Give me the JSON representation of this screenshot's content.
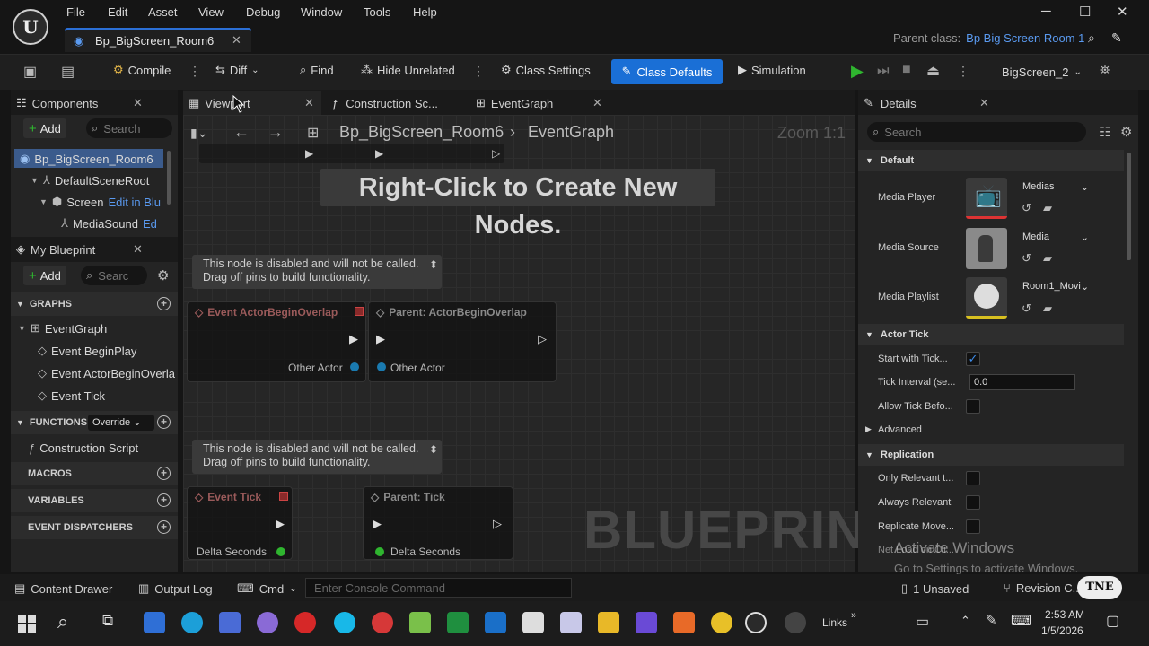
{
  "menu": [
    "File",
    "Edit",
    "Asset",
    "View",
    "Debug",
    "Window",
    "Tools",
    "Help"
  ],
  "doc_tab": "Bp_BigScreen_Room6",
  "parent_class": {
    "label": "Parent class:",
    "value": "Bp Big Screen Room 1"
  },
  "toolbar": {
    "compile": "Compile",
    "diff": "Diff",
    "find": "Find",
    "hide_unrelated": "Hide Unrelated",
    "class_settings": "Class Settings",
    "class_defaults": "Class Defaults",
    "simulation": "Simulation",
    "debug_object": "BigScreen_2"
  },
  "components": {
    "title": "Components",
    "add": "Add",
    "search_placeholder": "Search",
    "tree": [
      {
        "label": "Bp_BigScreen_Room6",
        "extra": ""
      },
      {
        "label": "DefaultSceneRoot",
        "extra": ""
      },
      {
        "label": "Screen",
        "extra": "Edit in Blu"
      },
      {
        "label": "MediaSound",
        "extra": "Ed"
      }
    ]
  },
  "my_blueprint": {
    "title": "My Blueprint",
    "add": "Add",
    "search_placeholder": "Searc",
    "graphs_label": "GRAPHS",
    "graphs": [
      "EventGraph",
      "Event BeginPlay",
      "Event ActorBeginOverla",
      "Event Tick"
    ],
    "functions_label": "FUNCTIONS (",
    "override_label": "Override",
    "functions": [
      "Construction Script"
    ],
    "macros_label": "MACROS",
    "variables_label": "VARIABLES",
    "dispatchers_label": "EVENT DISPATCHERS"
  },
  "graph_tabs": [
    "Viewport",
    "Construction Sc...",
    "EventGraph"
  ],
  "graph": {
    "breadcrumb_root": "Bp_BigScreen_Room6",
    "breadcrumb_leaf": "EventGraph",
    "zoom": "Zoom 1:1",
    "hint": "Right-Click to Create New Nodes.",
    "watermark": "BLUEPRINT",
    "disabled_note_1": "This node is disabled and will not be called.",
    "disabled_note_2": "Drag off pins to build functionality.",
    "node_overlap": "Event ActorBeginOverlap",
    "node_parent_overlap": "Parent: ActorBeginOverlap",
    "pin_other_actor": "Other Actor",
    "node_tick": "Event Tick",
    "node_parent_tick": "Parent: Tick",
    "pin_delta_seconds": "Delta Seconds"
  },
  "details": {
    "title": "Details",
    "search_placeholder": "Search",
    "default_label": "Default",
    "media_player_label": "Media Player",
    "media_player_value": "Medias",
    "media_source_label": "Media Source",
    "media_source_value": "Media",
    "media_playlist_label": "Media Playlist",
    "media_playlist_value": "Room1_Movi",
    "actor_tick_label": "Actor Tick",
    "start_with_tick": "Start with Tick...",
    "tick_interval": "Tick Interval (se...",
    "tick_interval_value": "0.0",
    "allow_tick_before": "Allow Tick Befo...",
    "advanced_label": "Advanced",
    "replication_label": "Replication",
    "only_relevant": "Only Relevant t...",
    "always_relevant": "Always Relevant",
    "replicate_movement": "Replicate Move...",
    "net_partial": "Net Load on Cli..."
  },
  "bottom": {
    "content_drawer": "Content Drawer",
    "output_log": "Output Log",
    "cmd": "Cmd",
    "console_placeholder": "Enter Console Command",
    "unsaved": "1 Unsaved",
    "revision_control": "Revision C..."
  },
  "activate": {
    "line1": "Activate Windows",
    "line2": "Go to Settings to activate Windows."
  },
  "taskbar": {
    "links": "Links",
    "time": "2:53 AM",
    "date": "1/5/2026"
  },
  "colors": {
    "accent": "#1a6fd6",
    "link": "#5a9af0",
    "play": "#2fb52f"
  }
}
